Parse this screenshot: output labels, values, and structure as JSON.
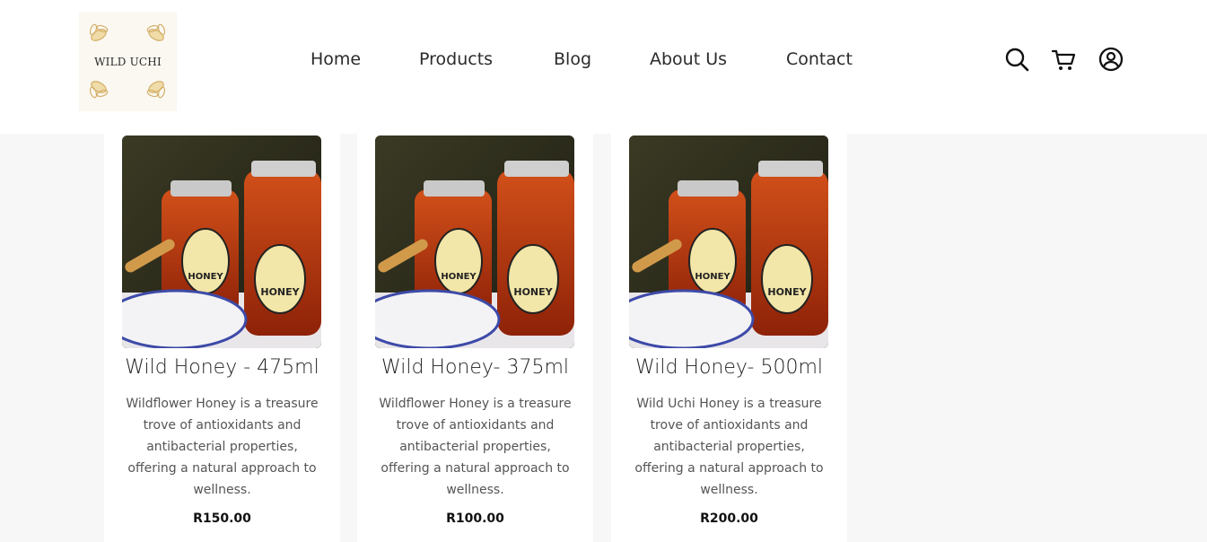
{
  "brand": {
    "logo_text": "WILD UCHI"
  },
  "nav": {
    "items": [
      {
        "label": "Home"
      },
      {
        "label": "Products"
      },
      {
        "label": "Blog"
      },
      {
        "label": "About Us"
      },
      {
        "label": "Contact"
      }
    ]
  },
  "header_icons": [
    "search-icon",
    "cart-icon",
    "account-icon"
  ],
  "products": [
    {
      "title": "Wild Honey - 475ml",
      "description": "Wildflower Honey is a treasure trove of antioxidants and antibacterial properties, offering a natural approach to wellness.",
      "price": "R150.00"
    },
    {
      "title": "Wild Honey- 375ml",
      "description": "Wildflower Honey is a treasure trove of antioxidants and antibacterial properties, offering a natural approach to wellness.",
      "price": "R100.00"
    },
    {
      "title": "Wild Honey- 500ml",
      "description": "Wild Uchi Honey is a treasure trove of antioxidants and antibacterial properties, offering a natural approach to wellness.",
      "price": "R200.00"
    }
  ],
  "product_image_label": "HONEY",
  "colors": {
    "header_bg": "#ffffff",
    "page_bg": "#f7f7f7",
    "honey": "#b8360f",
    "text": "#222222"
  }
}
